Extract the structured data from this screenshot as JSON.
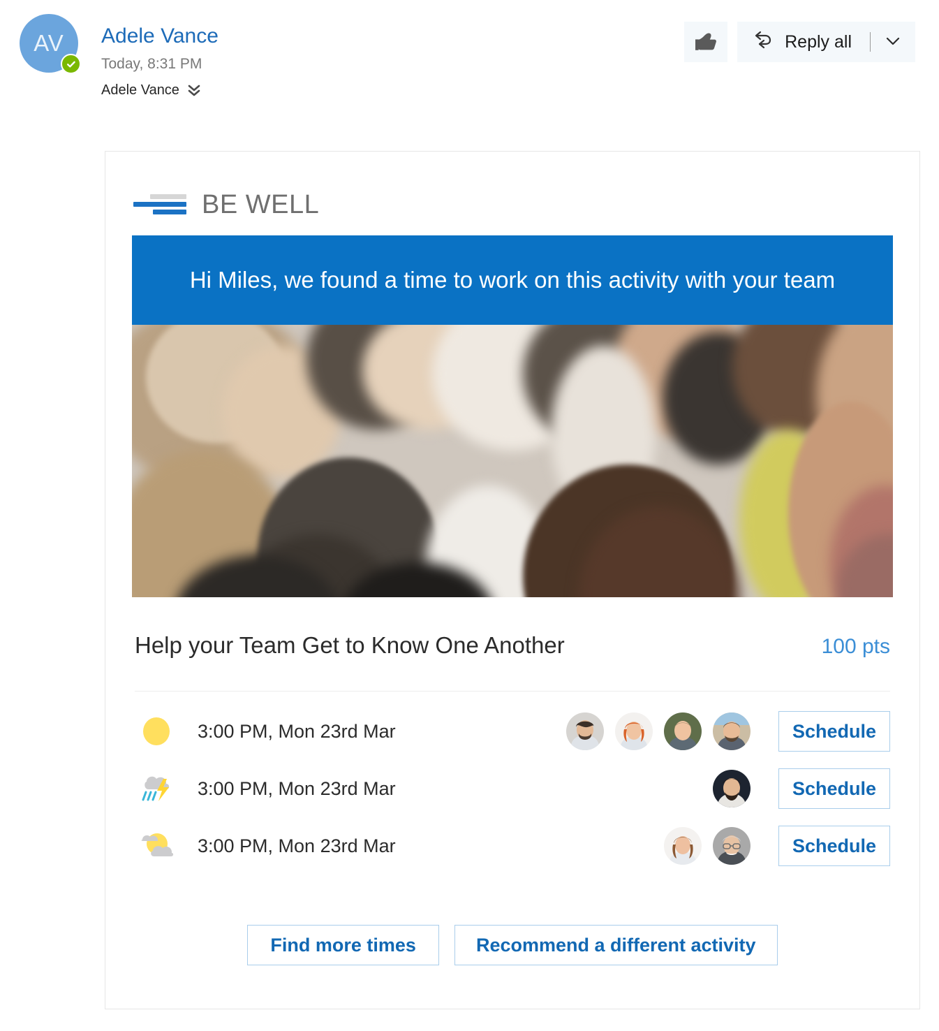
{
  "message": {
    "avatar_initials": "AV",
    "sender_name": "Adele Vance",
    "timestamp": "Today, 8:31 PM",
    "recipient_line": "Adele Vance",
    "presence_icon": "verified-check-icon",
    "expand_icon": "double-chevron-down-icon"
  },
  "toolbar": {
    "like_icon": "thumbs-up-icon",
    "reply_icon": "reply-all-icon",
    "reply_all_label": "Reply all",
    "dropdown_icon": "chevron-down-icon"
  },
  "card": {
    "brand": {
      "logo_text": "BE WELL",
      "logo_icon": "be-well-bars-logo",
      "bar_colors": [
        "#d6d6d6",
        "#1b72c4",
        "#1b72c4"
      ]
    },
    "hero": {
      "banner_text": "Hi Miles, we found a time to work on this activity with your team",
      "banner_color": "#0a72c4",
      "photo_alt": "group-of-people-embracing-in-circle"
    },
    "activity": {
      "title": "Help your Team Get to Know One Another",
      "points": "100 pts",
      "points_color": "#3b8ed6"
    },
    "slots": [
      {
        "weather_icon": "sunny-icon",
        "time": "3:00 PM, Mon 23rd Mar",
        "attendee_count": 4,
        "schedule_label": "Schedule"
      },
      {
        "weather_icon": "thunderstorm-rain-icon",
        "time": "3:00 PM, Mon 23rd Mar",
        "attendee_count": 1,
        "schedule_label": "Schedule"
      },
      {
        "weather_icon": "partly-cloudy-icon",
        "time": "3:00 PM, Mon 23rd Mar",
        "attendee_count": 2,
        "schedule_label": "Schedule"
      }
    ],
    "footer": {
      "find_more_times_label": "Find more times",
      "recommend_label": "Recommend a different activity"
    }
  }
}
